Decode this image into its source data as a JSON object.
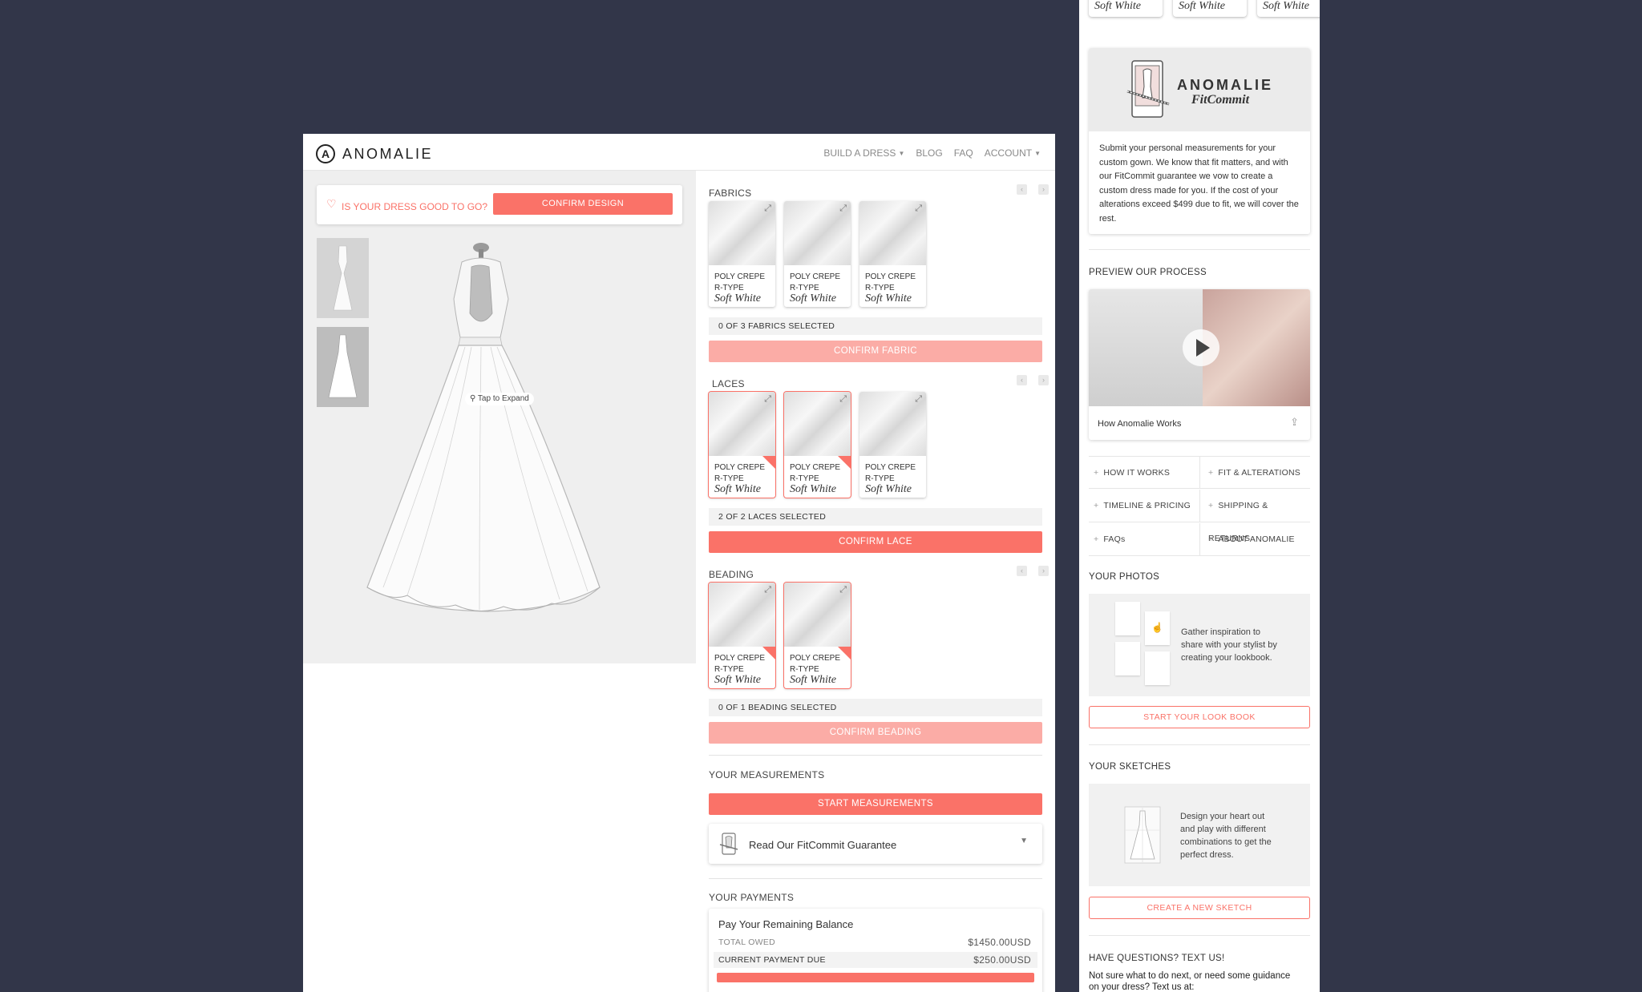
{
  "nav": {
    "brand": "ANOMALIE",
    "brand_mark": "A",
    "links": [
      "BUILD A DRESS",
      "BLOG",
      "FAQ",
      "ACCOUNT"
    ]
  },
  "design": {
    "question": "IS YOUR DRESS GOOD TO GO?",
    "confirm_label": "CONFIRM DESIGN",
    "tap_label": "Tap to Expand"
  },
  "swatch": {
    "line1": "POLY CREPE",
    "line2": "R-TYPE",
    "color_name": "Soft White"
  },
  "fabrics": {
    "title": "FABRICS",
    "status": "0 OF 3 FABRICS SELECTED",
    "confirm": "CONFIRM FABRIC"
  },
  "laces": {
    "title": "LACES",
    "status": "2 OF 2 LACES SELECTED",
    "confirm": "CONFIRM LACE"
  },
  "beading": {
    "title": "BEADING",
    "status": "0 OF 1 BEADING SELECTED",
    "confirm": "CONFIRM BEADING"
  },
  "measurements": {
    "title": "YOUR MEASUREMENTS",
    "start": "START MEASUREMENTS",
    "fitcommit_label": "Read Our FitCommit Guarantee"
  },
  "payments": {
    "title": "YOUR PAYMENTS",
    "card_title": "Pay Your Remaining Balance",
    "total_label": "TOTAL OWED",
    "total_value": "$1450.00USD",
    "due_label": "CURRENT PAYMENT DUE",
    "due_value": "$250.00USD"
  },
  "side": {
    "top_swatches": [
      "Soft White",
      "Soft White",
      "Soft White"
    ],
    "fitcommit": {
      "brand": "ANOMALIE",
      "sub": "FitCommit",
      "text": "Submit your personal measurements for your custom gown. We know that fit matters, and with our FitCommit guarantee we vow to create a custom dress made for you. If the cost of your alterations exceed $499 due to fit, we will cover the rest."
    },
    "preview_title": "PREVIEW OUR PROCESS",
    "video_caption": "How Anomalie Works",
    "links": [
      "HOW IT WORKS",
      "FIT & ALTERATIONS",
      "TIMELINE & PRICING",
      "SHIPPING & RETURNS",
      "FAQs",
      "ABOUT ANOMALIE"
    ],
    "photos": {
      "title": "YOUR PHOTOS",
      "text": "Gather inspiration to share with your stylist by creating your lookbook.",
      "button": "START YOUR LOOK BOOK"
    },
    "sketches": {
      "title": "YOUR SKETCHES",
      "text": "Design your heart out and play with different combinations to get the perfect dress.",
      "button": "CREATE A NEW SKETCH"
    },
    "questions": {
      "title": "HAVE QUESTIONS? TEXT US!",
      "text": "Not sure what to do next, or need some guidance on your dress? Text us at:"
    }
  },
  "colors": {
    "accent": "#fa7268",
    "accent_faded": "#fbaca6",
    "backdrop": "#323649"
  },
  "icons": [
    "heart-icon",
    "expand-icon",
    "chevron-left-icon",
    "chevron-right-icon",
    "play-icon",
    "share-icon",
    "plus-icon",
    "caret-down-icon",
    "magnifier-icon",
    "cursor-hand-icon"
  ]
}
